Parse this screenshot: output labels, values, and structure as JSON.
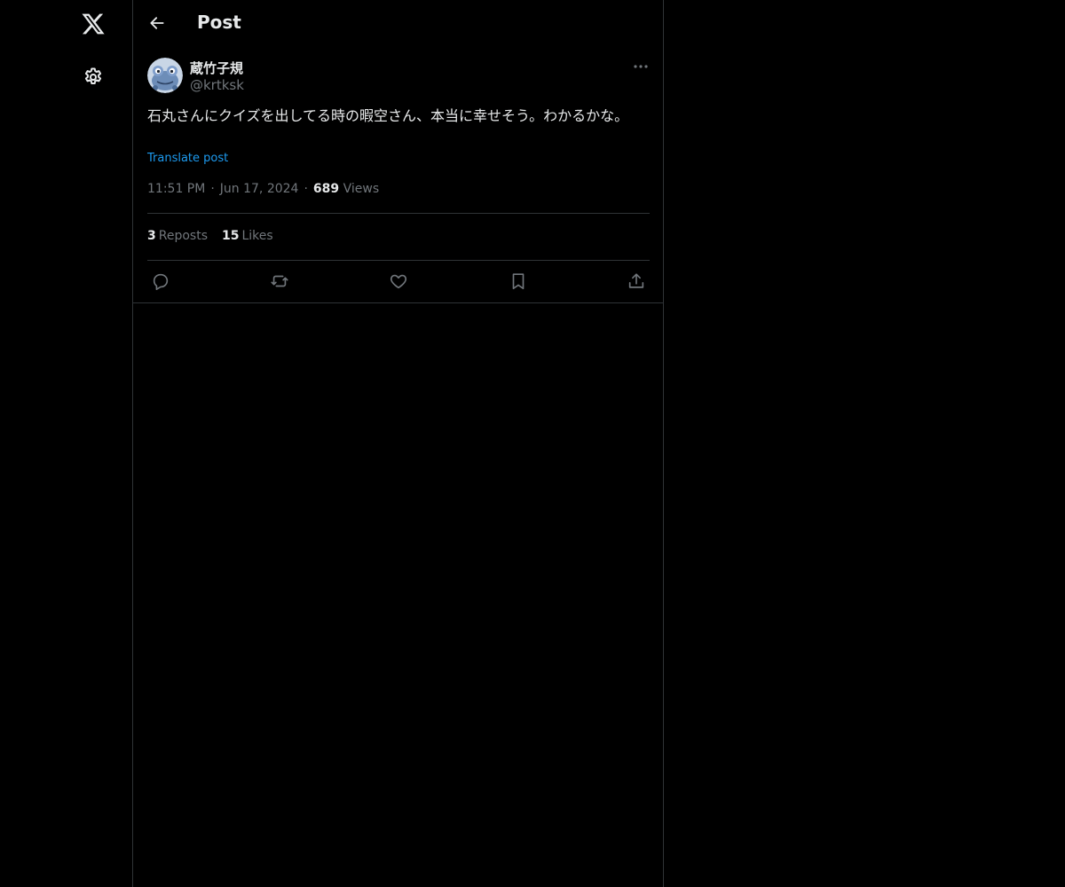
{
  "nav": {
    "logo_icon": "x-logo-icon",
    "settings_icon": "gear-icon"
  },
  "header": {
    "title": "Post"
  },
  "post": {
    "author": {
      "name": "蔵竹子規",
      "handle": "@krtksk"
    },
    "text": "石丸さんにクイズを出してる時の暇空さん、本当に幸せそう。わかるかな。",
    "translate_label": "Translate post",
    "time": "11:51 PM",
    "date": "Jun 17, 2024",
    "views_count": "689",
    "views_label": "Views",
    "reposts_count": "3",
    "reposts_label": "Reposts",
    "likes_count": "15",
    "likes_label": "Likes"
  },
  "colors": {
    "background": "#000000",
    "text_primary": "#e7e9ea",
    "text_secondary": "#71767b",
    "accent": "#1d9bf0",
    "border": "#2f3336"
  }
}
